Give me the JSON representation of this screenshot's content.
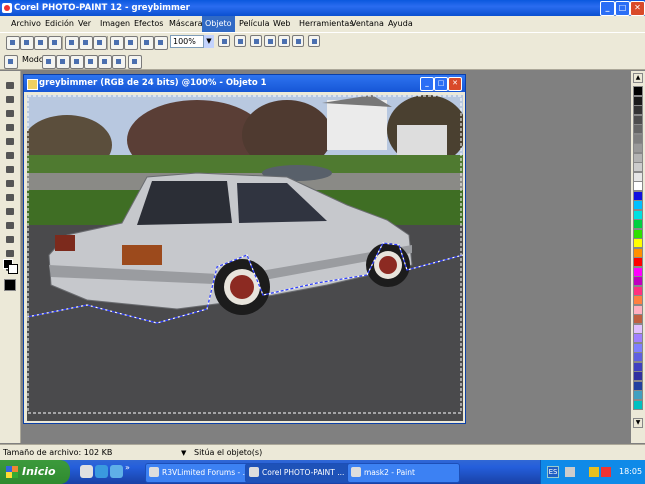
{
  "app": {
    "title": "Corel PHOTO-PAINT 12 - greybimmer",
    "minimize": "_",
    "maximize": "□",
    "close": "✕"
  },
  "menu": {
    "items": [
      "Archivo",
      "Edición",
      "Ver",
      "Imagen",
      "Efectos",
      "Máscara",
      "Objeto",
      "Película",
      "Web",
      "Herramientas",
      "Ventana",
      "Ayuda"
    ],
    "active": "Objeto"
  },
  "toolbar": {
    "zoom_value": "100%",
    "mode_label": "Modo"
  },
  "document": {
    "title": "greybimmer (RGB de 24 bits) @100% - Objeto 1"
  },
  "status": {
    "file_size": "Tamaño de archivo: 102 KB",
    "hint": "Sitúa el objeto(s)"
  },
  "taskbar": {
    "start_label": "Inicio",
    "tasks": [
      "R3VLimited Forums - ...",
      "Corel PHOTO-PAINT ...",
      "mask2 - Paint"
    ],
    "language": "ES",
    "clock": "18:05"
  },
  "palette": {
    "colors": [
      "#000000",
      "#1a1a1a",
      "#333333",
      "#4d4d4d",
      "#666666",
      "#808080",
      "#999999",
      "#b3b3b3",
      "#cccccc",
      "#e6e6e6",
      "#ffffff",
      "#1010e0",
      "#00c0ff",
      "#00e0e0",
      "#00d040",
      "#30e000",
      "#ffff00",
      "#ff9000",
      "#ff0000",
      "#ff00ff",
      "#c000c0",
      "#ff3080",
      "#ff8040",
      "#ffb0c0",
      "#c06040",
      "#e0c0ff",
      "#a080ff",
      "#8080ff",
      "#6060e0",
      "#4040c0",
      "#3030a0",
      "#2040a0",
      "#40a0c0",
      "#00c0c0"
    ]
  }
}
